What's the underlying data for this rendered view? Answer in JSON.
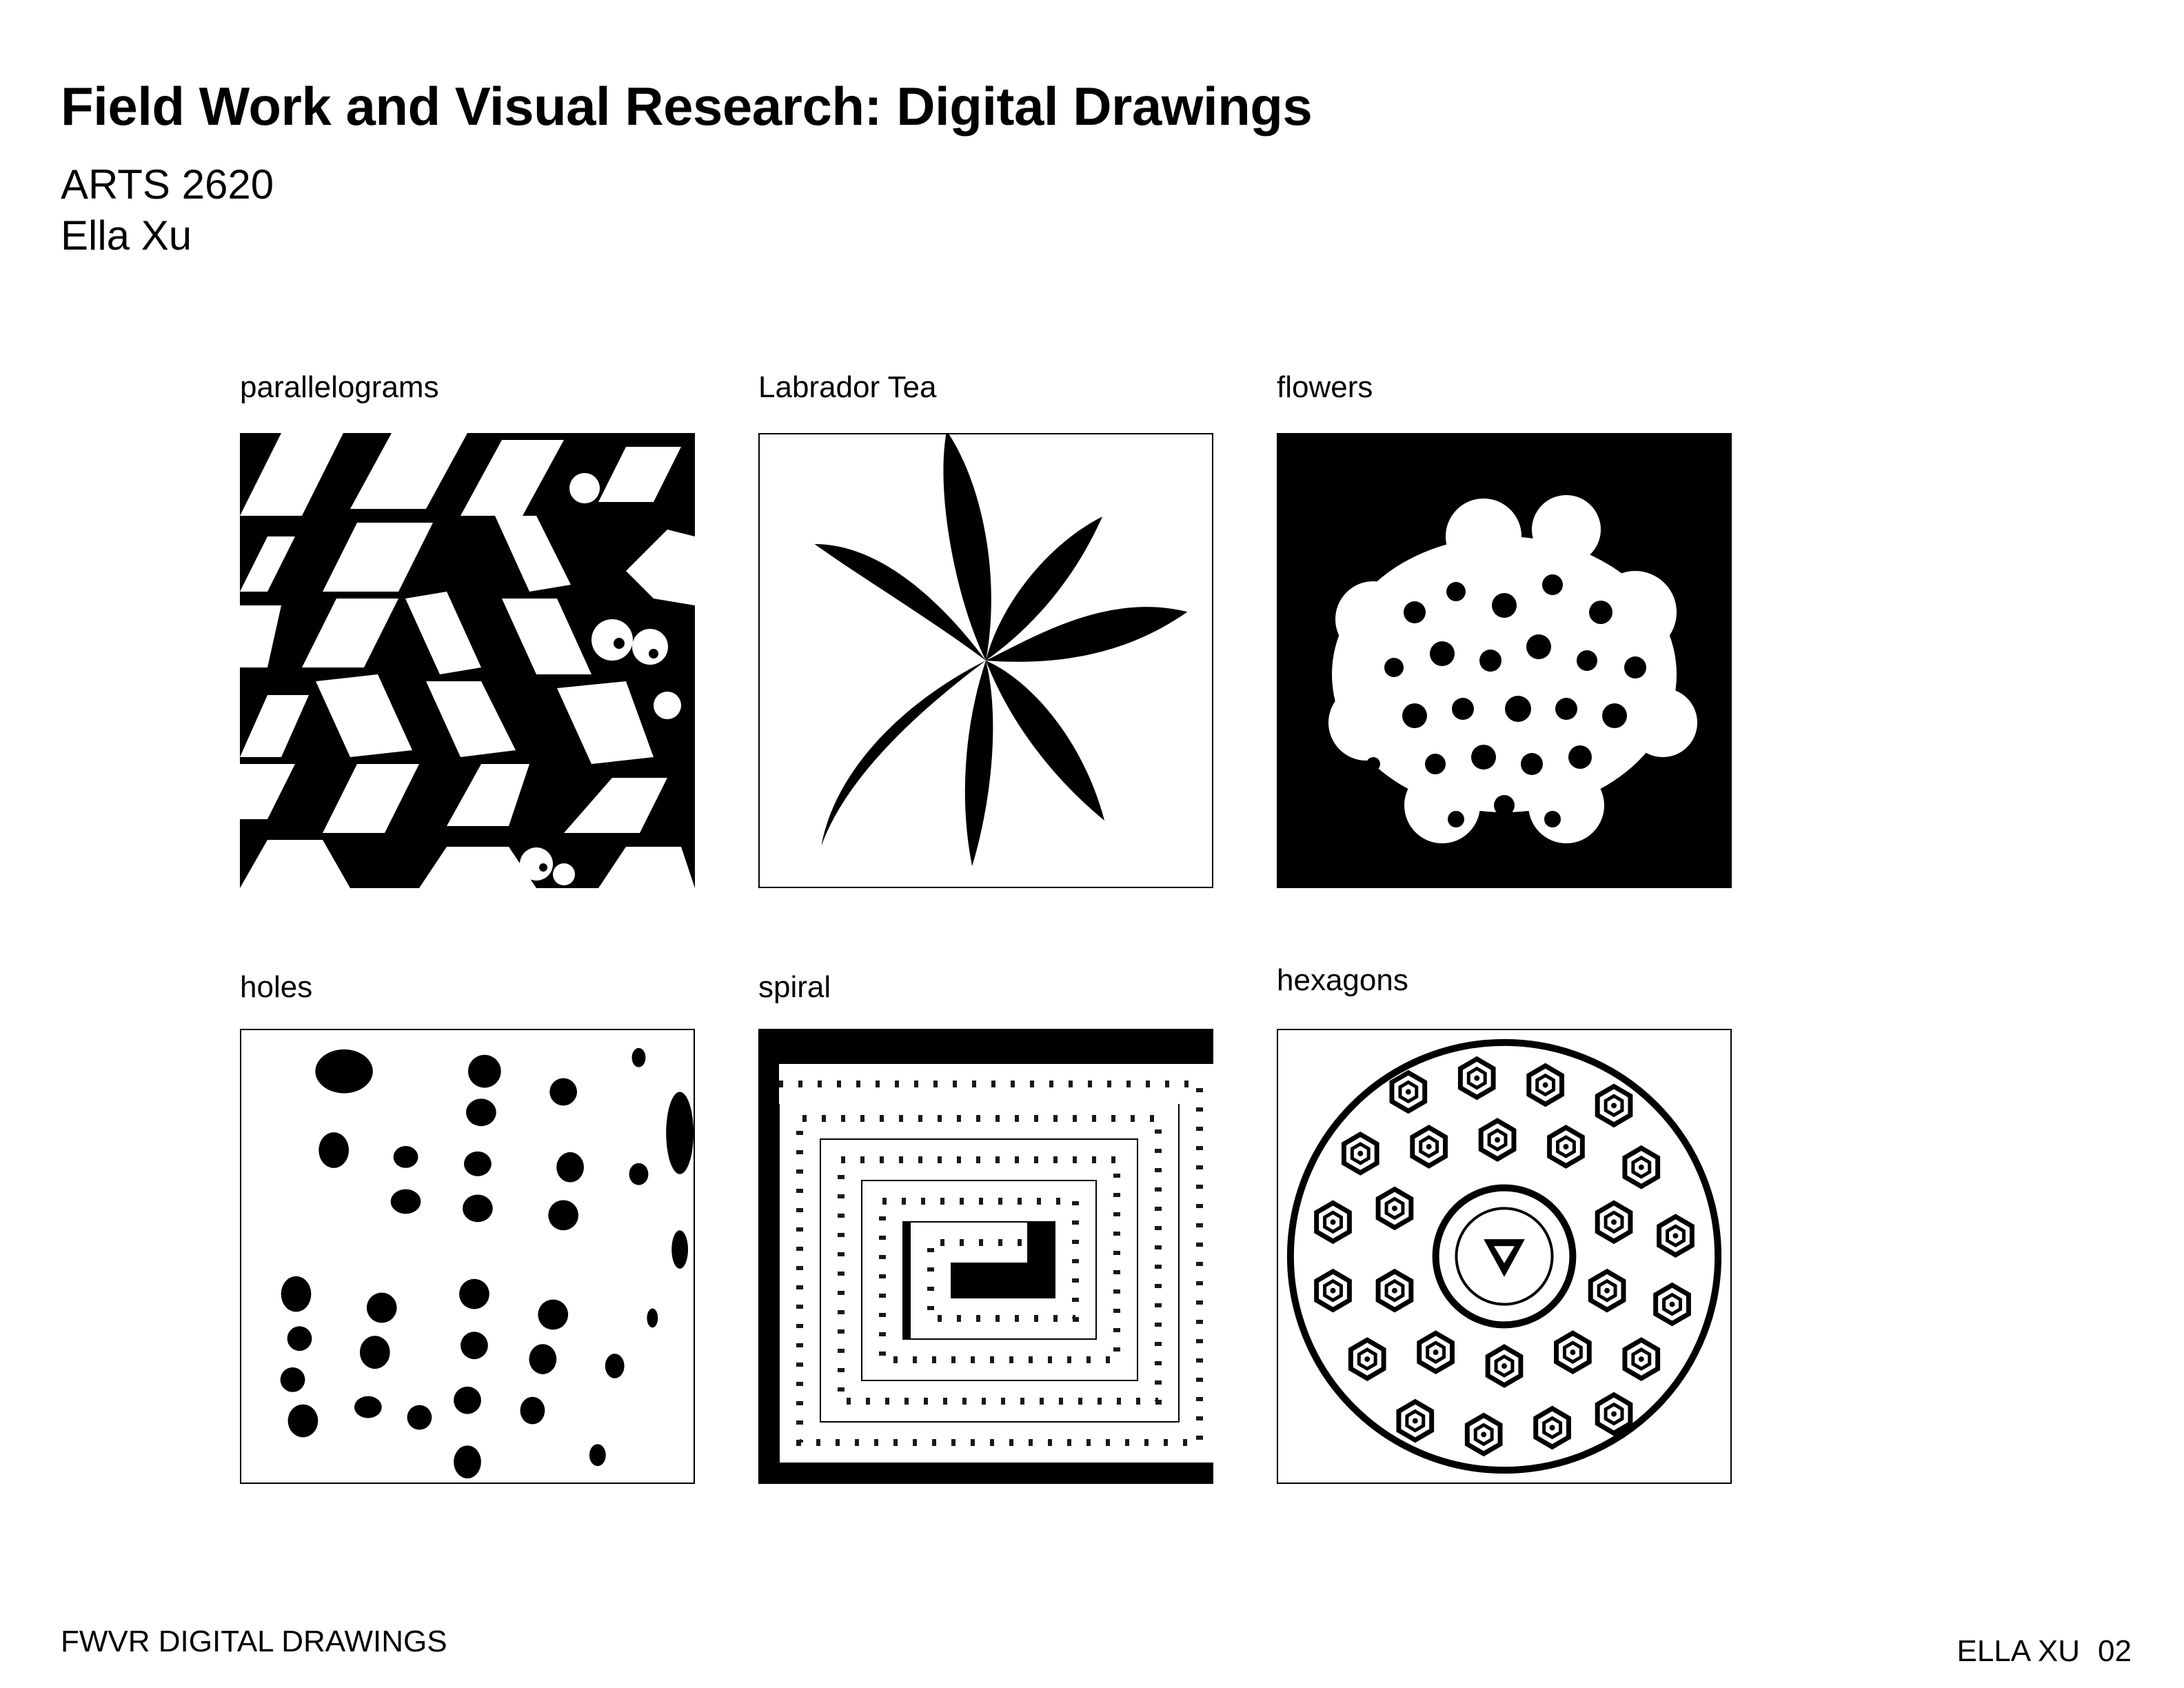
{
  "header": {
    "title": "Field Work and Visual Research: Digital Drawings",
    "course": "ARTS 2620",
    "author": "Ella Xu"
  },
  "panels": [
    {
      "label": "parallelograms",
      "icon": "parallelogram-pattern-drawing"
    },
    {
      "label": "Labrador Tea",
      "icon": "labrador-tea-leaf-drawing"
    },
    {
      "label": "flowers",
      "icon": "flower-cluster-drawing"
    },
    {
      "label": "holes",
      "icon": "holes-pattern-drawing"
    },
    {
      "label": "spiral",
      "icon": "spiral-drawing"
    },
    {
      "label": "hexagons",
      "icon": "hexagon-manhole-cover-drawing"
    }
  ],
  "footer": {
    "left": "FWVR DIGITAL DRAWINGS",
    "right_name": "ELLA XU",
    "page_number": "02"
  },
  "colors": {
    "ink": "#000000",
    "paper": "#ffffff"
  }
}
